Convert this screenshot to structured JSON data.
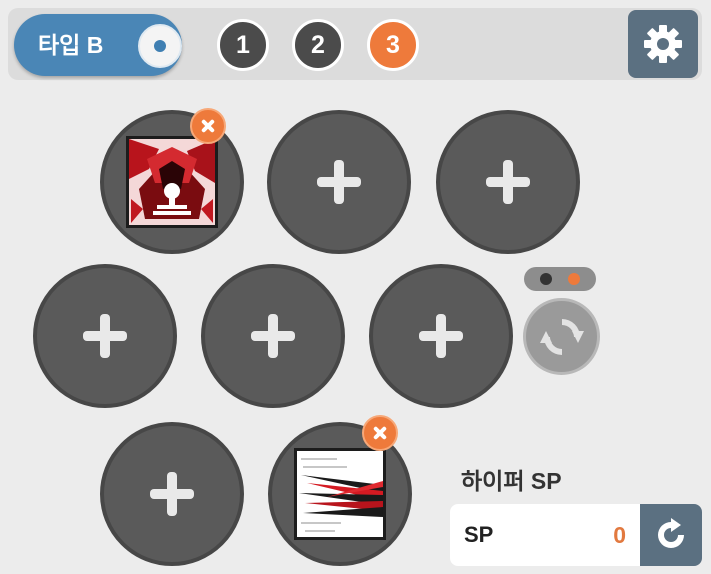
{
  "header": {
    "type_toggle_label": "타입 B",
    "pages": [
      {
        "label": "1",
        "active": false
      },
      {
        "label": "2",
        "active": false
      },
      {
        "label": "3",
        "active": true
      }
    ]
  },
  "slots": [
    {
      "state": "skill",
      "icon": "red-demon-skill-icon"
    },
    {
      "state": "empty"
    },
    {
      "state": "empty"
    },
    {
      "state": "empty"
    },
    {
      "state": "empty"
    },
    {
      "state": "empty"
    },
    {
      "state": "empty"
    },
    {
      "state": "skill",
      "icon": "red-slash-skill-icon"
    }
  ],
  "pager": {
    "count": 2,
    "active_index": 1
  },
  "hyper": {
    "title": "하이퍼 SP",
    "sp_label": "SP",
    "sp_value": "0"
  },
  "colors": {
    "accent_orange": "#ee7a3b",
    "toggle_blue": "#4a86b6",
    "slot_gray": "#5a5a5a",
    "settings_slate": "#5b7081"
  }
}
